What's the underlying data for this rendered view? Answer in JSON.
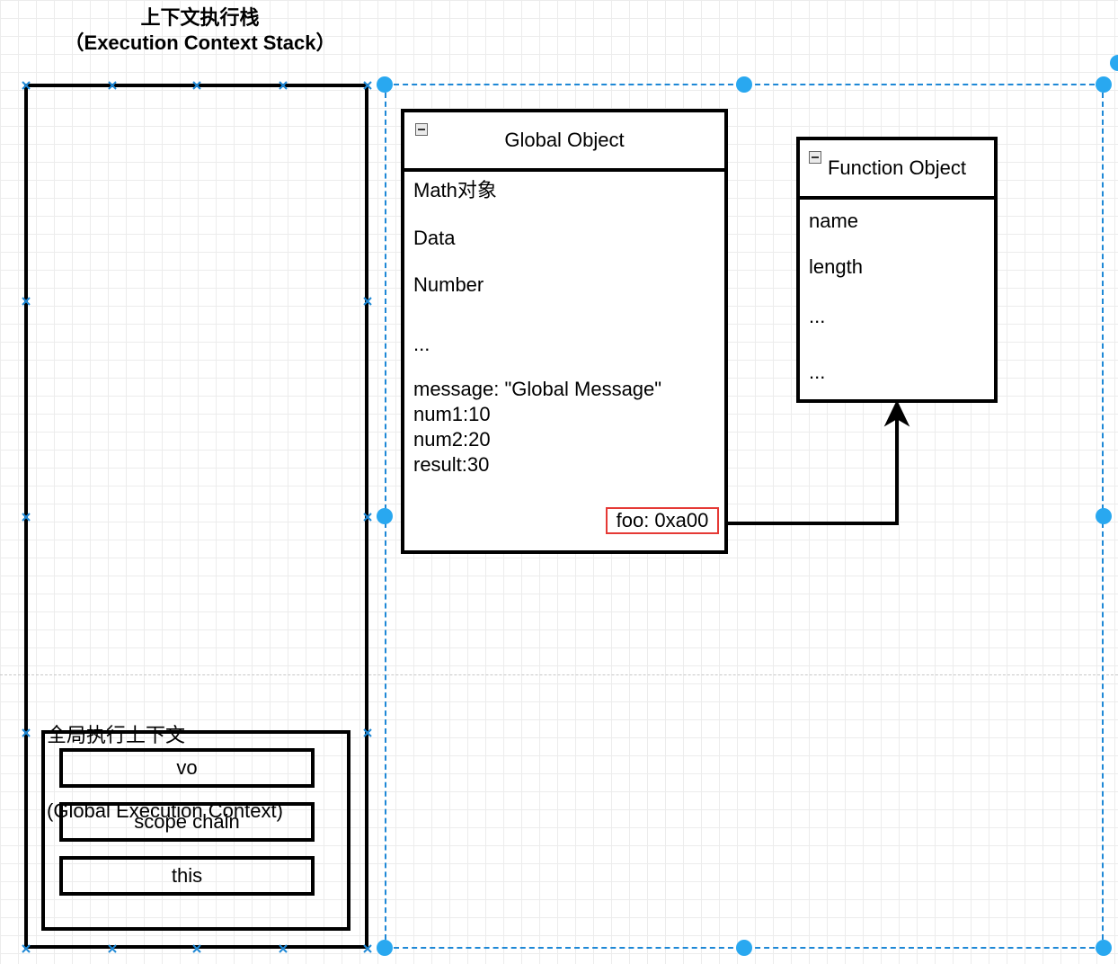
{
  "stack_title": {
    "zh": "上下文执行栈",
    "en": "（Execution Context Stack）"
  },
  "global_execution_context": {
    "label_zh": "全局执行上下文",
    "label_en": "(Global Execution Context)",
    "items": [
      "vo",
      "scope chain",
      "this"
    ]
  },
  "global_object": {
    "title": "Global Object",
    "fields": [
      "Math对象",
      "Data",
      "Number",
      "...",
      "message: \"Global Message\"",
      "num1:10",
      "num2:20",
      "result:30"
    ],
    "highlight": "foo: 0xa00"
  },
  "function_object": {
    "title": "Function Object",
    "fields": [
      "name",
      "length",
      "...",
      "..."
    ]
  },
  "colors": {
    "selection": "#1e88d6",
    "handle": "#29a8f0",
    "highlight_border": "#e53935"
  }
}
